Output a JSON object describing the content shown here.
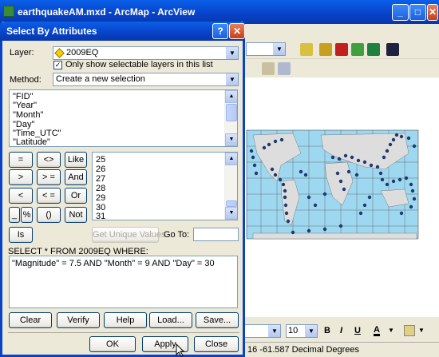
{
  "main_window": {
    "title": "earthquakeAM.mxd - ArcMap - ArcView",
    "minimize_label": "_",
    "maximize_label": "□",
    "close_label": "✕",
    "status_text": "16  -61.587 Decimal Degrees",
    "font_size_value": "10",
    "bold_label": "B",
    "italic_label": "I",
    "underline_label": "U",
    "font_color_label": "A"
  },
  "dialog": {
    "title": "Select By Attributes",
    "help_label": "?",
    "close_label": "✕",
    "layer_label": "Layer:",
    "layer_value": "2009EQ",
    "only_selectable_label": "Only show selectable layers in this list",
    "only_selectable_checked": true,
    "method_label": "Method:",
    "method_value": "Create a new selection",
    "fields": [
      "\"FID\"",
      "\"Year\"",
      "\"Month\"",
      "\"Day\"",
      "\"Time_UTC\"",
      "\"Latitude\""
    ],
    "operators": {
      "eq": "=",
      "ne": "<>",
      "like": "Like",
      "gt": ">",
      "ge": "> =",
      "and": "And",
      "lt": "<",
      "le": "< =",
      "or": "Or",
      "underscore": "_",
      "percent": "%",
      "parens": "()",
      "not": "Not",
      "is": "Is"
    },
    "unique_values": [
      "25",
      "26",
      "27",
      "28",
      "29",
      "30",
      "31"
    ],
    "get_unique_values_label": "Get Unique Values",
    "goto_label": "Go To:",
    "goto_value": "",
    "where_label": "SELECT * FROM 2009EQ WHERE:",
    "expression": "\"Magnitude\" = 7.5 AND \"Month\" = 9 AND \"Day\" = 30",
    "buttons": {
      "clear": "Clear",
      "verify": "Verify",
      "help": "Help",
      "load": "Load...",
      "save": "Save...",
      "ok": "OK",
      "apply": "Apply",
      "close": "Close"
    }
  }
}
